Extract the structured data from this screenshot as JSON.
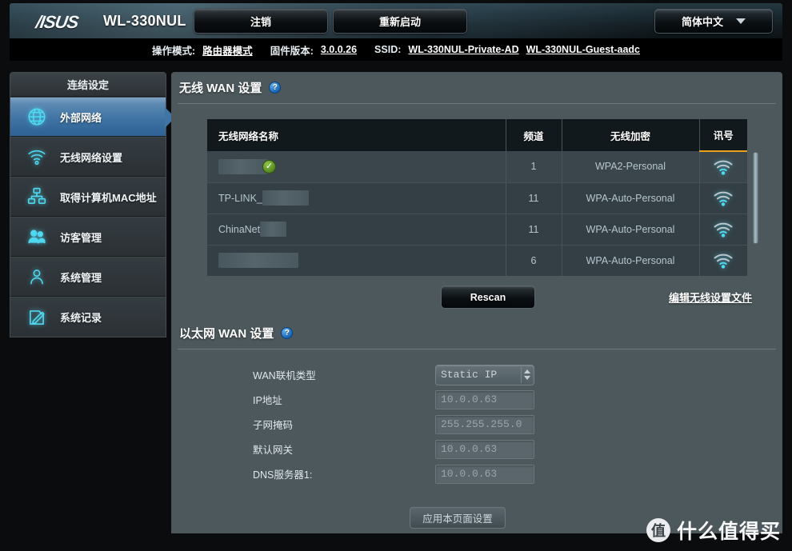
{
  "header": {
    "brand": "/ISUS",
    "model": "WL-330NUL",
    "logout_label": "注销",
    "reboot_label": "重新启动",
    "language_label": "简体中文",
    "caret_icon": "chevron-down-icon"
  },
  "infobar": {
    "op_mode_key": "操作模式:",
    "op_mode_value": "路由器模式",
    "firmware_key": "固件版本:",
    "firmware_value": "3.0.0.26",
    "ssid_key": "SSID:",
    "ssid_private": "WL-330NUL-Private-AD",
    "ssid_guest": "WL-330NUL-Guest-aadc"
  },
  "sidebar": {
    "title": "连结设定",
    "items": [
      {
        "label": "外部网络",
        "icon": "globe-icon",
        "active": true
      },
      {
        "label": "无线网络设置",
        "icon": "wifi-icon",
        "active": false
      },
      {
        "label": "取得计算机MAC地址",
        "icon": "network-nodes-icon",
        "active": false
      },
      {
        "label": "访客管理",
        "icon": "users-icon",
        "active": false
      },
      {
        "label": "系统管理",
        "icon": "person-icon",
        "active": false
      },
      {
        "label": "系统记录",
        "icon": "pencil-note-icon",
        "active": false
      }
    ]
  },
  "wireless_wan": {
    "title": "无线 WAN 设置",
    "help_icon": "question-mark-icon",
    "columns": [
      "无线网络名称",
      "频道",
      "无线加密",
      "讯号"
    ],
    "rows": [
      {
        "name": "",
        "redacted": true,
        "redact_width": 62,
        "selected": true,
        "channel": "1",
        "encryption": "WPA2-Personal",
        "signal_icon": "wifi-signal-icon"
      },
      {
        "name": "TP-LINK_",
        "redacted": true,
        "redact_width": 58,
        "selected": false,
        "channel": "11",
        "encryption": "WPA-Auto-Personal",
        "signal_icon": "wifi-signal-icon"
      },
      {
        "name": "ChinaNet",
        "redacted": true,
        "redact_width": 33,
        "selected": false,
        "channel": "11",
        "encryption": "WPA-Auto-Personal",
        "signal_icon": "wifi-signal-icon"
      },
      {
        "name": "",
        "redacted": true,
        "redact_width": 100,
        "selected": false,
        "channel": "6",
        "encryption": "WPA-Auto-Personal",
        "signal_icon": "wifi-signal-icon"
      }
    ],
    "rescan_label": "Rescan",
    "edit_profile_link": "编辑无线设置文件"
  },
  "ethernet_wan": {
    "title": "以太网 WAN 设置",
    "help_icon": "question-mark-icon",
    "fields": [
      {
        "label": "WAN联机类型",
        "value": "Static IP",
        "type": "select"
      },
      {
        "label": "IP地址",
        "value": "10.0.0.63",
        "type": "text"
      },
      {
        "label": "子网掩码",
        "value": "255.255.255.0",
        "type": "text"
      },
      {
        "label": "默认网关",
        "value": "10.0.0.63",
        "type": "text"
      },
      {
        "label": "DNS服务器1:",
        "value": "10.0.0.63",
        "type": "text"
      }
    ],
    "apply_label": "应用本页面设置"
  },
  "watermark": {
    "mark": "值",
    "text": "什么值得买"
  },
  "colors": {
    "accent_orange": "#e8a21a",
    "active_blue": "#3d72a3",
    "panel_gray": "#4c585c",
    "table_header": "#12191d",
    "cyan_icon": "#29d2e8"
  }
}
